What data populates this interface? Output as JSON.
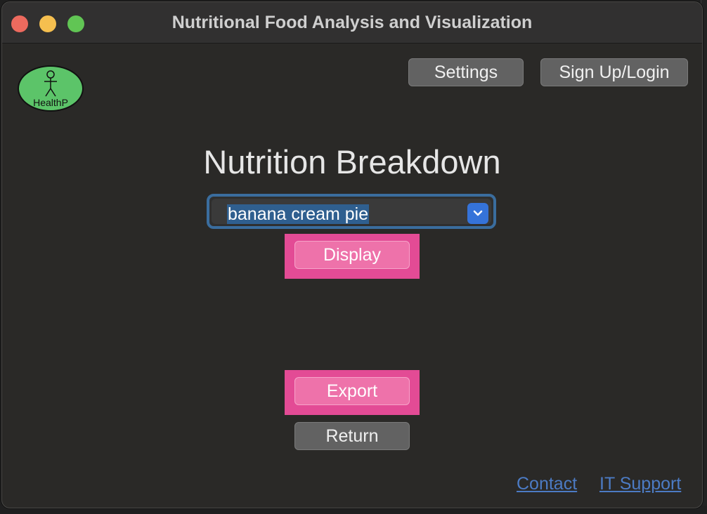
{
  "window": {
    "title": "Nutritional Food Analysis and Visualization"
  },
  "logo": {
    "text": "HealthP",
    "icon": "stick-figure-icon",
    "color": "#5cc469"
  },
  "header": {
    "settings_label": "Settings",
    "signup_label": "Sign Up/Login"
  },
  "main": {
    "heading": "Nutrition Breakdown",
    "food_select": {
      "selected": "banana cream pie"
    },
    "display_label": "Display",
    "export_label": "Export",
    "return_label": "Return"
  },
  "footer": {
    "contact_label": "Contact",
    "it_support_label": "IT Support"
  },
  "colors": {
    "window_bg": "#2a2927",
    "highlight_pink": "#e34b95",
    "button_pink": "#ee72aa",
    "select_border": "#3a6d9e",
    "select_arrow": "#3573d9",
    "link": "#4c7bc4"
  }
}
